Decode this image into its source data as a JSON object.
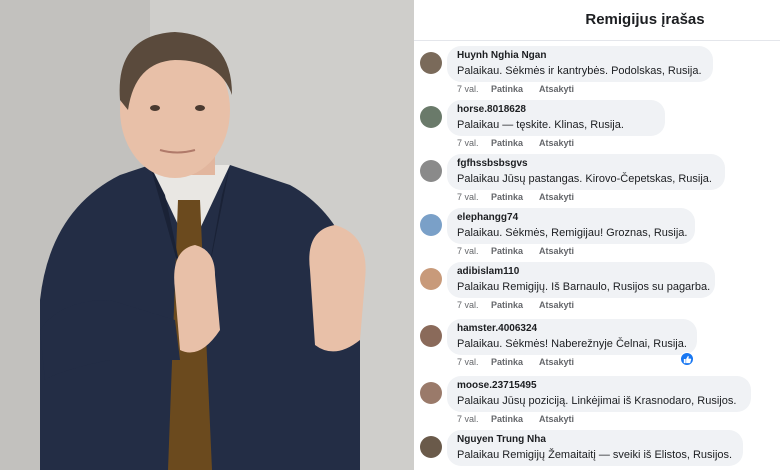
{
  "panel": {
    "title": "Remigijus įrašas"
  },
  "comments": [
    {
      "name": "Huynh Nghia Ngan",
      "text": "Palaikau. Sėkmės ir kantrybės. Podolskas, Rusija.",
      "time": "7 val.",
      "like": "Patinka",
      "reply": "Atsakyti",
      "avatar": "avatar-icon"
    },
    {
      "name": "horse.8018628",
      "text": "Palaikau — tęskite. Klinas, Rusija.",
      "time": "7 val.",
      "like": "Patinka",
      "reply": "Atsakyti",
      "avatar": "avatar-icon"
    },
    {
      "name": "fgfhssbsbsgvs",
      "text": "Palaikau Jūsų pastangas. Kirovo-Čepetskas, Rusija.",
      "time": "7 val.",
      "like": "Patinka",
      "reply": "Atsakyti",
      "avatar": "avatar-icon"
    },
    {
      "name": "elephangg74",
      "text": "Palaikau. Sėkmės, Remigijau! Groznas, Rusija.",
      "time": "7 val.",
      "like": "Patinka",
      "reply": "Atsakyti",
      "avatar": "avatar-icon"
    },
    {
      "name": "adibislam110",
      "text": "Palaikau Remigijų. Iš Barnaulo, Rusijos su pagarba.",
      "time": "7 val.",
      "like": "Patinka",
      "reply": "Atsakyti",
      "avatar": "avatar-icon"
    },
    {
      "name": "hamster.4006324",
      "text": "Palaikau. Sėkmės! Naberežnyje Čelnai, Rusija.",
      "time": "7 val.",
      "like": "Patinka",
      "reply": "Atsakyti",
      "avatar": "avatar-icon",
      "reaction": "like-reaction-icon"
    },
    {
      "name": "moose.23715495",
      "text": "Palaikau Jūsų poziciją. Linkėjimai iš Krasnodaro, Rusijos.",
      "time": "7 val.",
      "like": "Patinka",
      "reply": "Atsakyti",
      "avatar": "avatar-icon"
    },
    {
      "name": "Nguyen Trung Nha",
      "text": "Palaikau Remigijų Žemaitaitį — sveiki iš Elistos, Rusijos.",
      "avatar": "avatar-icon"
    }
  ],
  "colors": {
    "bubble": "#f0f2f5",
    "text": "#1c1e21",
    "meta": "#65676b",
    "like_blue": "#1877f2"
  }
}
